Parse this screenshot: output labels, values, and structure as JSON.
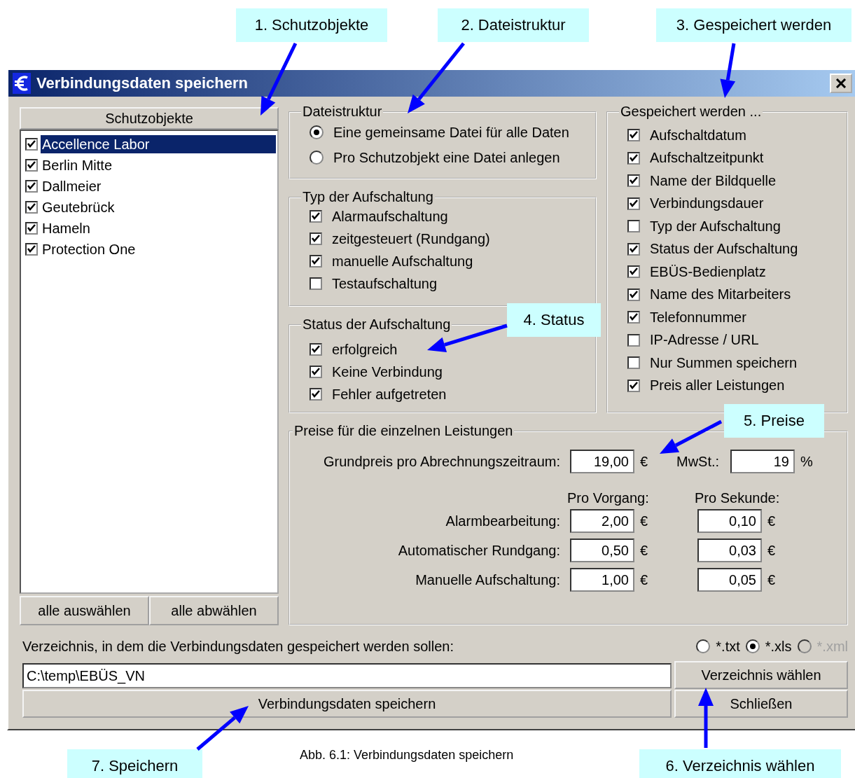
{
  "callouts": [
    {
      "label": "1. Schutzobjekte"
    },
    {
      "label": "2. Dateistruktur"
    },
    {
      "label": "3. Gespeichert werden"
    },
    {
      "label": "4. Status"
    },
    {
      "label": "5. Preise"
    },
    {
      "label": "7. Speichern"
    },
    {
      "label": "6. Verzeichnis wählen"
    }
  ],
  "window": {
    "title": "Verbindungsdaten speichern"
  },
  "objects": {
    "header": "Schutzobjekte",
    "items": [
      {
        "label": "Accellence Labor",
        "checked": true,
        "selected": true
      },
      {
        "label": "Berlin Mitte",
        "checked": true,
        "selected": false
      },
      {
        "label": "Dallmeier",
        "checked": true,
        "selected": false
      },
      {
        "label": "Geutebrück",
        "checked": true,
        "selected": false
      },
      {
        "label": "Hameln",
        "checked": true,
        "selected": false
      },
      {
        "label": "Protection One",
        "checked": true,
        "selected": false
      }
    ],
    "buttons": [
      "alle auswählen",
      "alle abwählen"
    ]
  },
  "file_structure": {
    "title": "Dateistruktur",
    "options": [
      {
        "label": "Eine gemeinsame Datei für alle Daten",
        "selected": true
      },
      {
        "label": "Pro Schutzobjekt eine Datei anlegen",
        "selected": false
      }
    ]
  },
  "connection_type": {
    "title": "Typ der Aufschaltung",
    "items": [
      {
        "label": "Alarmaufschaltung",
        "checked": true
      },
      {
        "label": "zeitgesteuert (Rundgang)",
        "checked": true
      },
      {
        "label": "manuelle Aufschaltung",
        "checked": true
      },
      {
        "label": "Testaufschaltung",
        "checked": false
      }
    ]
  },
  "status": {
    "title": "Status der Aufschaltung",
    "items": [
      {
        "label": "erfolgreich",
        "checked": true
      },
      {
        "label": "Keine Verbindung",
        "checked": true
      },
      {
        "label": "Fehler aufgetreten",
        "checked": true
      }
    ]
  },
  "saved_fields": {
    "title": "Gespeichert werden ...",
    "items": [
      {
        "label": "Aufschaltdatum",
        "checked": true
      },
      {
        "label": "Aufschaltzeitpunkt",
        "checked": true
      },
      {
        "label": "Name der Bildquelle",
        "checked": true
      },
      {
        "label": "Verbindungsdauer",
        "checked": true
      },
      {
        "label": "Typ der Aufschaltung",
        "checked": false
      },
      {
        "label": "Status der Aufschaltung",
        "checked": true
      },
      {
        "label": "EBÜS-Bedienplatz",
        "checked": true
      },
      {
        "label": "Name des Mitarbeiters",
        "checked": true
      },
      {
        "label": "Telefonnummer",
        "checked": true
      },
      {
        "label": "IP-Adresse / URL",
        "checked": false
      },
      {
        "label": "Nur Summen speichern",
        "checked": false
      },
      {
        "label": "Preis aller Leistungen",
        "checked": true
      }
    ]
  },
  "prices": {
    "title": "Preise für die einzelnen Leistungen",
    "base_label": "Grundpreis pro Abrechnungszeitraum:",
    "base_value": "19,00",
    "base_unit": "€",
    "vat_label": "MwSt.:",
    "vat_value": "19",
    "vat_unit": "%",
    "column_headers": [
      "Pro Vorgang:",
      "Pro Sekunde:"
    ],
    "rows": [
      {
        "label": "Alarmbearbeitung:",
        "per_event": "2,00",
        "per_event_unit": "€",
        "per_second": "0,10",
        "per_second_unit": "€"
      },
      {
        "label": "Automatischer Rundgang:",
        "per_event": "0,50",
        "per_event_unit": "€",
        "per_second": "0,03",
        "per_second_unit": "€"
      },
      {
        "label": "Manuelle Aufschaltung:",
        "per_event": "1,00",
        "per_event_unit": "€",
        "per_second": "0,05",
        "per_second_unit": "€"
      }
    ]
  },
  "directory": {
    "label": "Verzeichnis, in dem die Verbindungsdaten gespeichert werden sollen:",
    "formats": [
      {
        "label": "*.txt",
        "selected": false,
        "disabled": false
      },
      {
        "label": "*.xls",
        "selected": true,
        "disabled": false
      },
      {
        "label": "*.xml",
        "selected": false,
        "disabled": true
      }
    ],
    "path": "C:\\temp\\EBÜS_VN",
    "choose_button": "Verzeichnis wählen"
  },
  "buttons": {
    "save": "Verbindungsdaten speichern",
    "close": "Schließen"
  },
  "caption": "Abb. 6.1: Verbindungsdaten speichern"
}
